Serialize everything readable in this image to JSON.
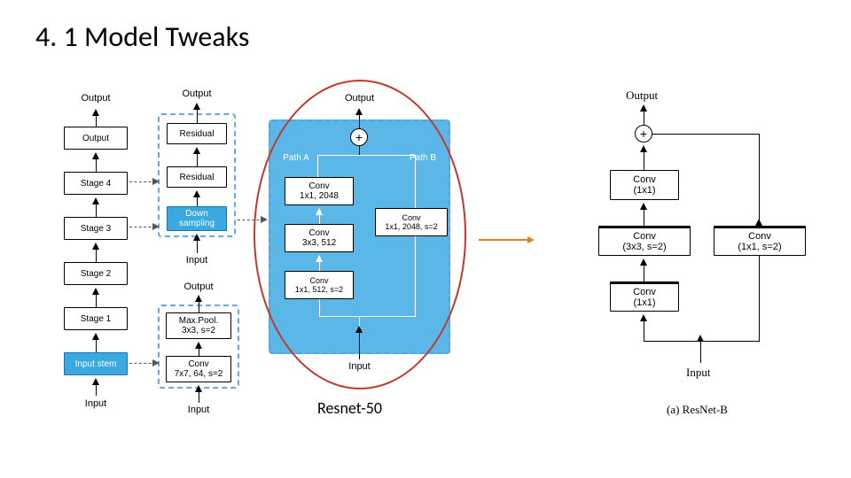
{
  "title": "4. 1 Model Tweaks",
  "col1": {
    "output": "Output",
    "s4": "Stage 4",
    "s3": "Stage 3",
    "s2": "Stage 2",
    "s1": "Stage 1",
    "stem": "Input stem",
    "input": "Input",
    "outbox": "Output"
  },
  "col2a": {
    "output": "Output",
    "res1": "Residual",
    "res2": "Residual",
    "down": "Down sampling",
    "input": "Input"
  },
  "col2b": {
    "output": "Output",
    "mp1": "Max.Pool.",
    "mp2": "3x3, s=2",
    "c1": "Conv",
    "c2": "7x7, 64, s=2",
    "input": "Input"
  },
  "col3": {
    "output": "Output",
    "pathA": "Path A",
    "pathB": "Path B",
    "a1a": "Conv",
    "a1b": "1x1, 2048",
    "a2a": "Conv",
    "a2b": "3x3, 512",
    "a3a": "Conv",
    "a3b": "1x1, 512, s=2",
    "b1a": "Conv",
    "b1b": "1x1, 2048, s=2",
    "input": "Input"
  },
  "caption_center": "Resnet-50",
  "col4": {
    "output": "Output",
    "c1": "Conv",
    "c1b": "(1x1)",
    "c2": "Conv",
    "c2b": "(3x3, s=2)",
    "c3": "Conv",
    "c3b": "(1x1)",
    "side1": "Conv",
    "side2": "(1x1, s=2)",
    "input": "Input",
    "caption": "(a) ResNet-B"
  }
}
